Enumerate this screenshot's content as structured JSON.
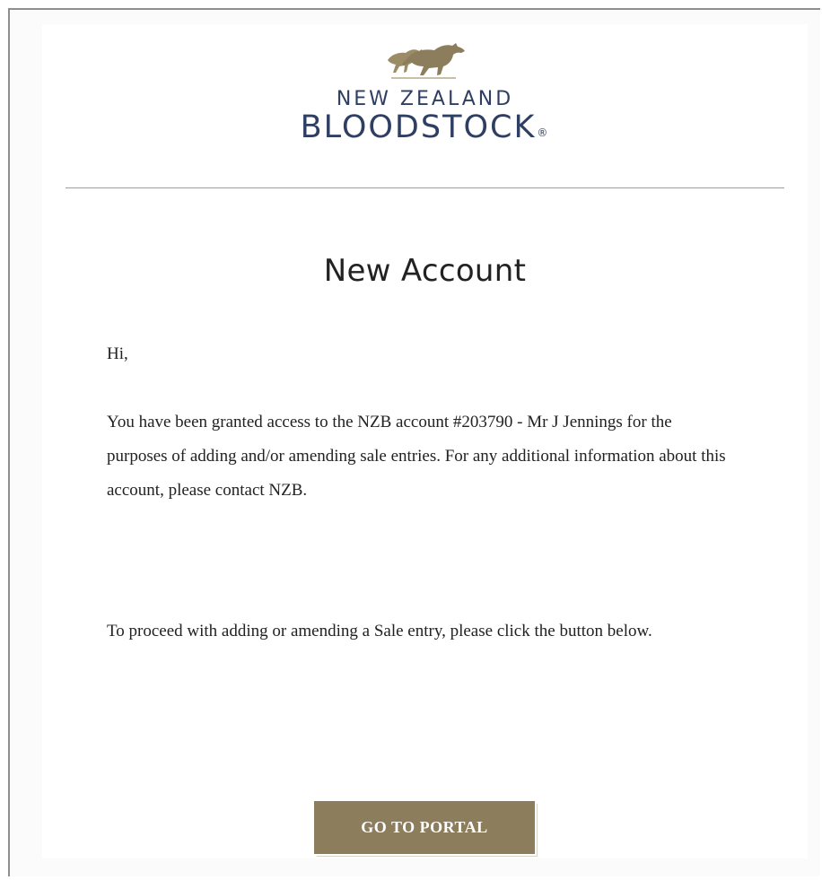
{
  "brand": {
    "logo_line1": "NEW ZEALAND",
    "logo_line2": "BLOODSTOCK",
    "registered_mark": "®",
    "logo_icon": "horses-icon",
    "accent_color": "#8c7d5c",
    "brand_color": "#2f3e63"
  },
  "email": {
    "title": "New Account",
    "greeting": "Hi,",
    "paragraph1": "You have been granted access to the NZB account #203790 - Mr J Jennings for the purposes of adding and/or amending sale entries. For any additional information about this account, please contact NZB.",
    "paragraph2": "To proceed with adding or amending a Sale entry, please click the button below.",
    "cta_label": "GO TO PORTAL"
  }
}
